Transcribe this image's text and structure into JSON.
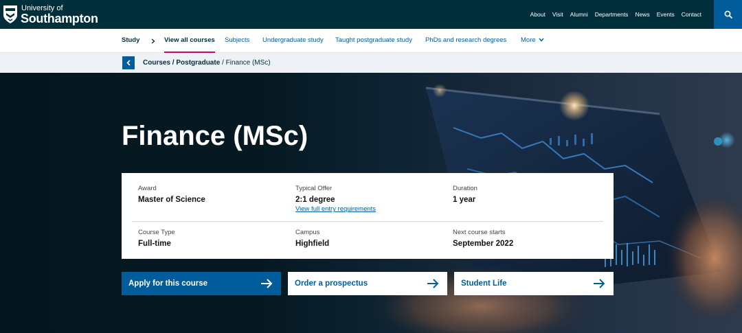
{
  "header": {
    "logo_line1": "University of",
    "logo_line2": "Southampton",
    "utility_nav": [
      "About",
      "Visit",
      "Alumni",
      "Departments",
      "News",
      "Events",
      "Contact"
    ],
    "search_icon": "search-icon"
  },
  "subnav": {
    "study": "Study",
    "items": [
      "View all courses",
      "Subjects",
      "Undergraduate study",
      "Taught postgraduate study",
      "PhDs and research degrees"
    ],
    "more": "More"
  },
  "breadcrumb": {
    "courses": "Courses",
    "separator": " / ",
    "postgraduate": "Postgraduate",
    "current": "Finance (MSc)"
  },
  "hero": {
    "title": "Finance (MSc)"
  },
  "course_info": {
    "award": {
      "label": "Award",
      "value": "Master of Science"
    },
    "typical_offer": {
      "label": "Typical Offer",
      "value": "2:1 degree",
      "link": "View full entry requirements"
    },
    "duration": {
      "label": "Duration",
      "value": "1 year"
    },
    "course_type": {
      "label": "Course Type",
      "value": "Full-time"
    },
    "campus": {
      "label": "Campus",
      "value": "Highfield"
    },
    "next_start": {
      "label": "Next course starts",
      "value": "September 2022"
    }
  },
  "actions": {
    "apply": "Apply for this course",
    "prospectus": "Order a prospectus",
    "student_life": "Student Life"
  },
  "colors": {
    "navy": "#002e3b",
    "brand_blue": "#005c9a",
    "accent_pink": "#d5006d",
    "crumb_bg": "#eef1f6"
  }
}
